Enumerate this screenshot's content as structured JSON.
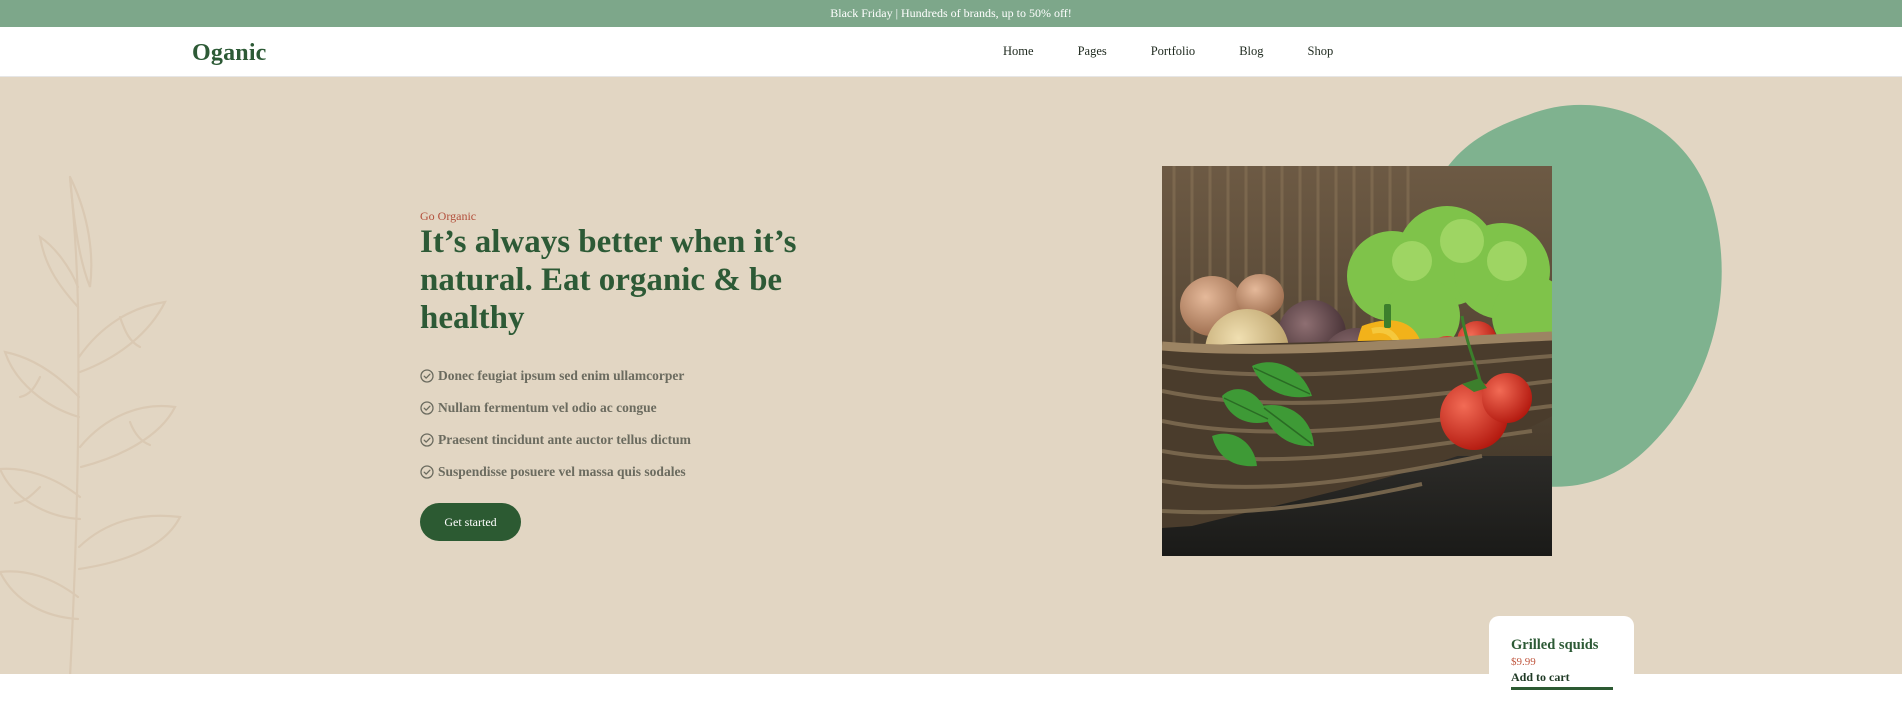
{
  "promo": {
    "text": "Black Friday | Hundreds of brands, up to 50% off!"
  },
  "header": {
    "logo": "Oganic",
    "nav": [
      "Home",
      "Pages",
      "Portfolio",
      "Blog",
      "Shop"
    ]
  },
  "hero": {
    "eyebrow": "Go Organic",
    "title": "It’s always better when it’s natural. Eat organic & be healthy",
    "features": [
      "Donec feugiat ipsum sed enim ullamcorper",
      "Nullam fermentum vel odio ac congue",
      "Praesent tincidunt ante auctor tellus dictum",
      "Suspendisse posuere vel massa quis sodales"
    ],
    "cta_label": "Get started"
  },
  "product_card": {
    "name": "Grilled squids",
    "price": "$9.99",
    "cta_label": "Add to cart"
  },
  "colors": {
    "brand_green": "#2d5a36",
    "promo_bg": "#7da78a",
    "hero_bg": "#e2d6c3",
    "accent_red": "#b24e3a",
    "blob_green": "#7fb28f"
  },
  "icons": {
    "feature_check": "check-circle-icon",
    "hero_image": "vegetable-basket-image",
    "decoration": "leaf-plant-decoration"
  }
}
